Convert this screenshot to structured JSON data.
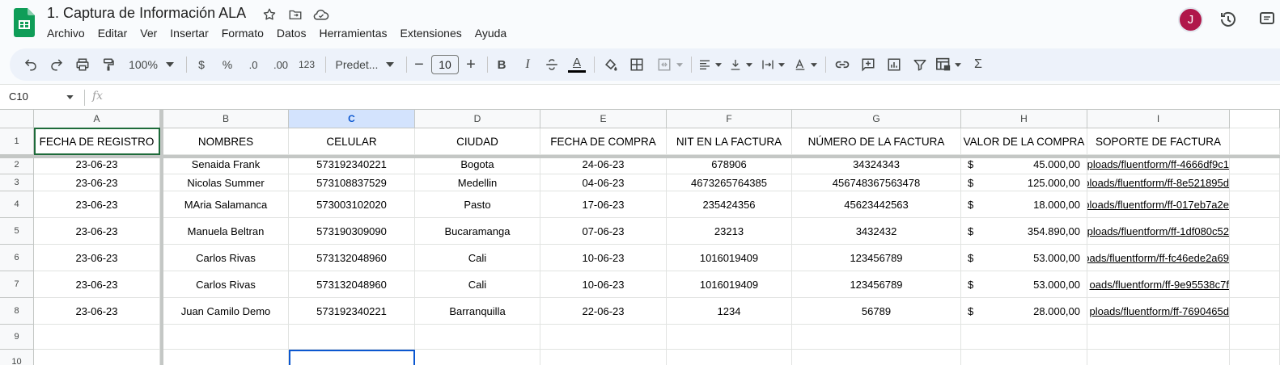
{
  "app": {
    "title": "1. Captura de Información ALA",
    "avatar_initial": "J",
    "menu": [
      "Archivo",
      "Editar",
      "Ver",
      "Insertar",
      "Formato",
      "Datos",
      "Herramientas",
      "Extensiones",
      "Ayuda"
    ]
  },
  "icons": {
    "logo": "sheets-logo-icon",
    "star": "star-icon",
    "move": "folder-move-icon",
    "cloud": "cloud-status-icon",
    "history": "history-icon",
    "comments": "comments-icon"
  },
  "toolbar": {
    "zoom": "100%",
    "currency": "$",
    "percent": "%",
    "decrease_decimals": ".0",
    "increase_decimals": ".00",
    "number_format": "123",
    "font": "Predet...",
    "font_size": "10",
    "bold": "B",
    "italic": "I",
    "text_color": "A",
    "sum": "Σ"
  },
  "formula_bar": {
    "cell_ref": "C10",
    "fx": "fx",
    "value": ""
  },
  "colors": {
    "accent": "#0b57d0",
    "brand_green": "#0f9d58",
    "avatar": "#b0174a",
    "active_col_header": "#d3e3fd"
  },
  "sheet": {
    "columns": [
      "A",
      "B",
      "C",
      "D",
      "E",
      "F",
      "G",
      "H",
      "I"
    ],
    "selected_column": "C",
    "row_numbers": [
      "1",
      "2",
      "3",
      "4",
      "5",
      "6",
      "7",
      "8",
      "9",
      "10"
    ],
    "headers": [
      "FECHA DE REGISTRO",
      "NOMBRES",
      "CELULAR",
      "CIUDAD",
      "FECHA DE COMPRA",
      "NIT EN LA FACTURA",
      "NÚMERO DE LA FACTURA",
      "VALOR DE LA COMPRA",
      "SOPORTE DE FACTURA"
    ],
    "rows": [
      {
        "fecha_registro": "23-06-23",
        "nombres": "Senaida Frank",
        "celular": "573192340221",
        "ciudad": "Bogota",
        "fecha_compra": "24-06-23",
        "nit": "678906",
        "numero_factura": "34324343",
        "moneda": "$",
        "valor": "45.000,00",
        "soporte": "ploads/fluentform/ff-4666df9c1"
      },
      {
        "fecha_registro": "23-06-23",
        "nombres": "Nicolas Summer",
        "celular": "573108837529",
        "ciudad": "Medellin",
        "fecha_compra": "04-06-23",
        "nit": "4673265764385",
        "numero_factura": "456748367563478",
        "moneda": "$",
        "valor": "125.000,00",
        "soporte": "ploads/fluentform/ff-8e521895d"
      },
      {
        "fecha_registro": "23-06-23",
        "nombres": "MAria Salamanca",
        "celular": "573003102020",
        "ciudad": "Pasto",
        "fecha_compra": "17-06-23",
        "nit": "235424356",
        "numero_factura": "45623442563",
        "moneda": "$",
        "valor": "18.000,00",
        "soporte": "ploads/fluentform/ff-017eb7a2e"
      },
      {
        "fecha_registro": "23-06-23",
        "nombres": "Manuela Beltran",
        "celular": "573190309090",
        "ciudad": "Bucaramanga",
        "fecha_compra": "07-06-23",
        "nit": "23213",
        "numero_factura": "3432432",
        "moneda": "$",
        "valor": "354.890,00",
        "soporte": "uploads/fluentform/ff-1df080c52"
      },
      {
        "fecha_registro": "23-06-23",
        "nombres": "Carlos Rivas",
        "celular": "573132048960",
        "ciudad": "Cali",
        "fecha_compra": "10-06-23",
        "nit": "1016019409",
        "numero_factura": "123456789",
        "moneda": "$",
        "valor": "53.000,00",
        "soporte": "oads/fluentform/ff-fc46ede2a69"
      },
      {
        "fecha_registro": "23-06-23",
        "nombres": "Carlos Rivas",
        "celular": "573132048960",
        "ciudad": "Cali",
        "fecha_compra": "10-06-23",
        "nit": "1016019409",
        "numero_factura": "123456789",
        "moneda": "$",
        "valor": "53.000,00",
        "soporte": "oads/fluentform/ff-9e95538c7f"
      },
      {
        "fecha_registro": "23-06-23",
        "nombres": "Juan Camilo Demo",
        "celular": "573192340221",
        "ciudad": "Barranquilla",
        "fecha_compra": "22-06-23",
        "nit": "1234",
        "numero_factura": "56789",
        "moneda": "$",
        "valor": "28.000,00",
        "soporte": "ploads/fluentform/ff-7690465d"
      }
    ]
  }
}
